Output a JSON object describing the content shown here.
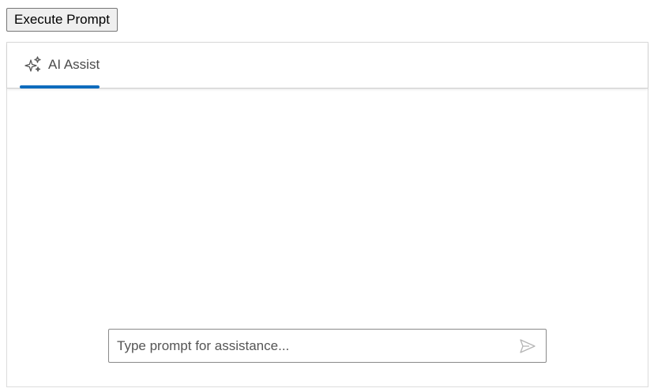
{
  "toolbar": {
    "execute_label": "Execute Prompt"
  },
  "assist_panel": {
    "tabs": [
      {
        "label": "AI Assist",
        "icon": "sparkle-icon",
        "active": true
      }
    ],
    "prompt": {
      "value": "",
      "placeholder": "Type prompt for assistance..."
    },
    "send_icon": "send-icon"
  },
  "colors": {
    "accent": "#0f6cbd",
    "icon_gray": "#555555",
    "send_gray": "#b5b5b5"
  }
}
